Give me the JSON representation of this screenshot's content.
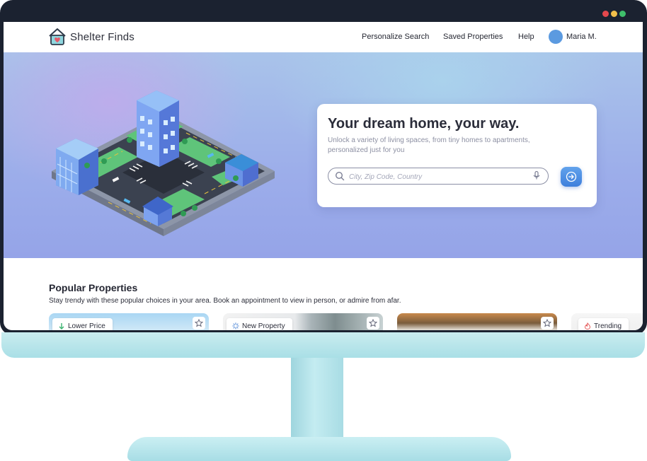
{
  "colors": {
    "brand_blue": "#4f8fe6",
    "hero_gradient_start": "#b3a6e8",
    "hero_gradient_end": "#95a4e8",
    "window_dot_red": "#e5484d",
    "window_dot_yellow": "#f2c04b",
    "window_dot_green": "#3fbf6b",
    "monitor_stand": "#a9dfe6",
    "lower_price_arrow": "#3cb371",
    "trending_icon": "#e55a5a"
  },
  "header": {
    "brand_name": "Shelter Finds",
    "logo_icon": "house-heart-icon",
    "nav": {
      "personalize_search": "Personalize Search",
      "saved_properties": "Saved Properties",
      "help": "Help"
    },
    "user_name": "Maria M."
  },
  "hero": {
    "title": "Your dream home, your way.",
    "subtitle": "Unlock a variety of living spaces, from tiny homes to apartments, personalized just for you",
    "search": {
      "placeholder": "City, Zip Code, Country",
      "value": ""
    },
    "illustration": "isometric-city-block"
  },
  "popular": {
    "title": "Popular Properties",
    "subtitle": "Stay trendy with these popular choices in your area. Book an appointment to view in person, or admire from afar.",
    "cards": [
      {
        "badge": "Lower Price",
        "badge_icon": "arrow-down-icon"
      },
      {
        "badge": "New Property",
        "badge_icon": "sparkle-icon"
      },
      {
        "badge": "",
        "badge_icon": ""
      },
      {
        "badge": "Trending",
        "badge_icon": "flame-icon"
      }
    ]
  }
}
